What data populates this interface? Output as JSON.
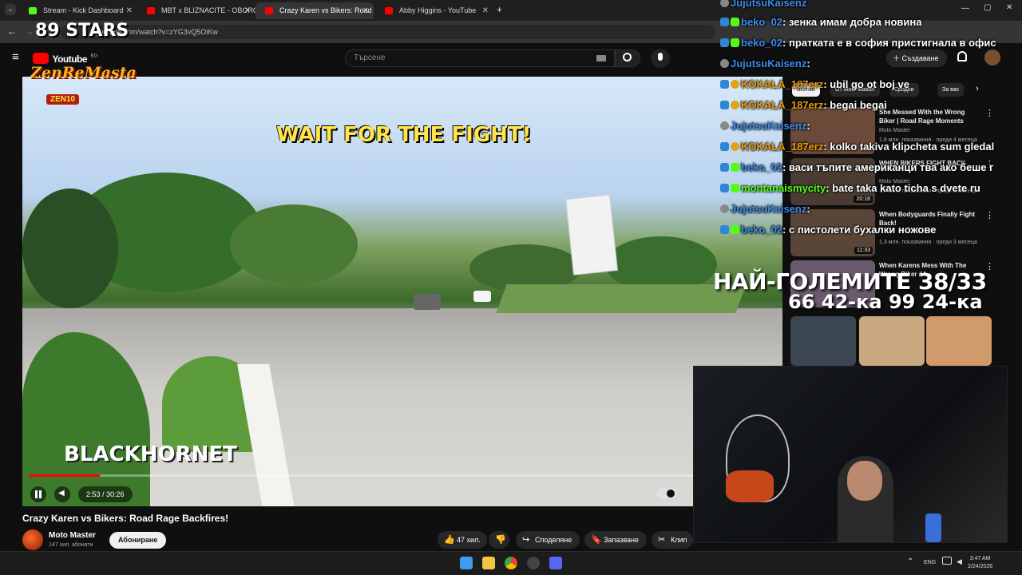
{
  "browser": {
    "tabs": [
      {
        "label": "Stream - Kick Dashboard",
        "color": "#53fc18"
      },
      {
        "label": "MBT x BLIZNACITE - OBOROTI",
        "color": "#ff0000"
      },
      {
        "label": "Crazy Karen vs Bikers: Road",
        "color": "#ff0000"
      },
      {
        "label": "Abby Higgins - YouTube",
        "color": "#ff0000"
      }
    ],
    "url": "youtube.com/watch?v=zYG3vQ5OiKw"
  },
  "youtube": {
    "logo": "Youtube",
    "logo_region": "BG",
    "search_placeholder": "Търсене",
    "create_label": "Създаване",
    "chips": [
      "Всички",
      "От Moto Master",
      "Сродни",
      "За вас"
    ]
  },
  "video": {
    "caption_top": "WAIT FOR THE FIGHT!",
    "caption_bottom": "BLACKHORNET",
    "time": "2:53 / 30:26",
    "progress_fraction": 0.095,
    "title": "Crazy Karen vs Bikers: Road Rage Backfires!",
    "channel": "Moto Master",
    "subscribers": "147 хил. абонати",
    "subscribe_label": "Абониране",
    "likes": "47 хил.",
    "share_label": "Споделяне",
    "save_label": "Запазване",
    "clip_label": "Клип"
  },
  "recommended": [
    {
      "title": "She Messed With the Wrong Biker | Road Rage Moments",
      "channel": "Moto Master",
      "meta": "1,8 млн. показвания · преди 4 месеца",
      "duration": ""
    },
    {
      "title": "WHEN BIKERS FIGHT BACK",
      "channel": "Moto Master",
      "meta": "1,4 млн. показвания · преди 2 месеца",
      "duration": "20:16"
    },
    {
      "title": "When Bodyguards Finally Fight Back!",
      "channel": "",
      "meta": "1,3 млн. показвания · преди 3 месеца",
      "duration": "11:33"
    },
    {
      "title": "When Karens Mess With The Wrong Biker #4",
      "channel": "",
      "meta": "",
      "duration": ""
    }
  ],
  "chat": [
    {
      "user": "JujutsuKaisenz",
      "text": "",
      "color": "#3b8be8"
    },
    {
      "user": "beko_02",
      "text": ": зенка имам добра новина",
      "color": "#3b8be8"
    },
    {
      "user": "beko_02",
      "text": ": пратката е в софия пристигнала в офис",
      "color": "#3b8be8"
    },
    {
      "user": "JujutsuKaisenz",
      "text": ":",
      "color": "#3b8be8"
    },
    {
      "user": "KOKALA_187erz",
      "text": ": ubil go ot boj ve",
      "color": "#e89b0c"
    },
    {
      "user": "KOKALA_187erz",
      "text": ": begai begai",
      "color": "#e89b0c"
    },
    {
      "user": "JujutsuKaisenz",
      "text": ":",
      "color": "#3b8be8"
    },
    {
      "user": "KOKALA_187erz",
      "text": ": kolko takiva klipcheta sum gledal",
      "color": "#e89b0c"
    },
    {
      "user": "beko_02",
      "text": ": васи тъпите американци тва ако беше г",
      "color": "#3b8be8"
    },
    {
      "user": "montanaismycity",
      "text": ": bate taka kato ticha s dvete ru",
      "color": "#53fc18"
    },
    {
      "user": "JujutsuKaisenz",
      "text": ":",
      "color": "#3b8be8"
    },
    {
      "user": "beko_02",
      "text": ": с пистолети бухалки ножове",
      "color": "#3b8be8"
    }
  ],
  "overlay": {
    "big": "НАЙ-ГОЛЕМИТЕ 38/33",
    "small": "66 42-ка 99 24-ка",
    "logo_89": "89 STARS",
    "logo_zen": "ZenReMasta",
    "logo_zen_sub": "ZEN10"
  },
  "taskbar": {
    "lang": "ENG",
    "time": "3:47 AM",
    "date": "2/24/2026"
  }
}
